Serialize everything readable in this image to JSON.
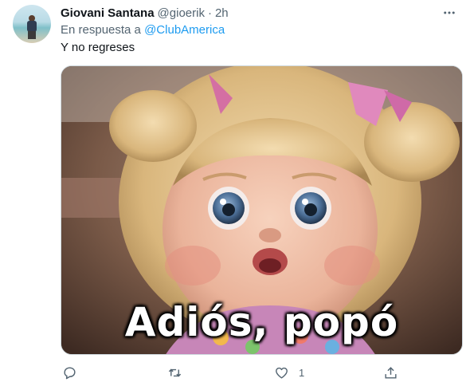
{
  "tweet": {
    "display_name": "Giovani Santana",
    "handle": "@gioerik",
    "separator": "·",
    "time": "2h",
    "reply_prefix": "En respuesta a",
    "reply_to": "@ClubAmerica",
    "text": "Y no regreses",
    "media_caption": "Adiós, popó"
  },
  "actions": {
    "reply_count": "",
    "retweet_count": "",
    "like_count": "1"
  },
  "icons": {
    "more": "more-horizontal-icon",
    "reply": "reply-icon",
    "retweet": "retweet-icon",
    "like": "heart-icon",
    "share": "share-icon"
  },
  "colors": {
    "accent": "#1d9bf0",
    "text_primary": "#0f1419",
    "text_secondary": "#536471"
  }
}
